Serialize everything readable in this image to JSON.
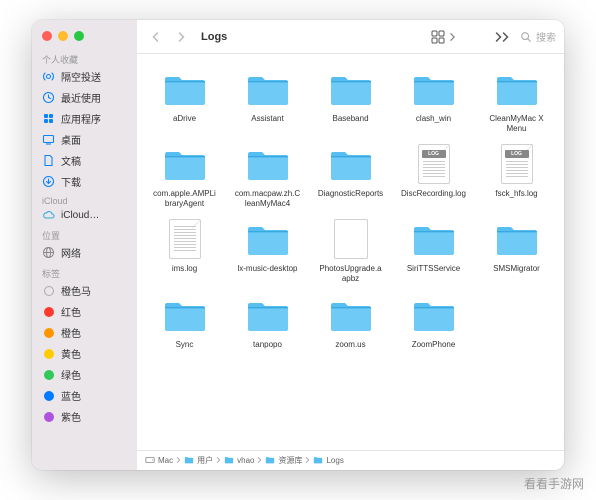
{
  "window_title": "Logs",
  "sidebar": {
    "sections": [
      {
        "header": "个人收藏",
        "items": [
          {
            "icon": "airdrop",
            "label": "隔空投送",
            "color": "#0a84ff"
          },
          {
            "icon": "clock",
            "label": "最近使用",
            "color": "#0a84ff"
          },
          {
            "icon": "apps",
            "label": "应用程序",
            "color": "#0a84ff"
          },
          {
            "icon": "desktop",
            "label": "桌面",
            "color": "#0a84ff"
          },
          {
            "icon": "doc",
            "label": "文稿",
            "color": "#0a84ff"
          },
          {
            "icon": "download",
            "label": "下载",
            "color": "#0a84ff"
          }
        ]
      },
      {
        "header": "iCloud",
        "items": [
          {
            "icon": "cloud",
            "label": "iCloud…",
            "color": "#34aadc"
          }
        ]
      },
      {
        "header": "位置",
        "items": [
          {
            "icon": "globe",
            "label": "网络",
            "color": "#888"
          }
        ]
      },
      {
        "header": "标签",
        "items": [
          {
            "icon": "tag",
            "label": "橙色马",
            "color": "#aaa"
          },
          {
            "icon": "tag",
            "label": "红色",
            "color": "#ff3b30"
          },
          {
            "icon": "tag",
            "label": "橙色",
            "color": "#ff9500"
          },
          {
            "icon": "tag",
            "label": "黄色",
            "color": "#ffcc00"
          },
          {
            "icon": "tag",
            "label": "绿色",
            "color": "#34c759"
          },
          {
            "icon": "tag",
            "label": "蓝色",
            "color": "#007aff"
          },
          {
            "icon": "tag",
            "label": "紫色",
            "color": "#af52de"
          }
        ]
      }
    ]
  },
  "search_placeholder": "搜索",
  "items": [
    {
      "type": "folder",
      "name": "aDrive"
    },
    {
      "type": "folder",
      "name": "Assistant"
    },
    {
      "type": "folder",
      "name": "Baseband"
    },
    {
      "type": "folder",
      "name": "clash_win"
    },
    {
      "type": "folder",
      "name": "CleanMyMac X Menu"
    },
    {
      "type": "folder",
      "name": "com.apple.AMPLibraryAgent"
    },
    {
      "type": "folder",
      "name": "com.macpaw.zh.CleanMyMac4"
    },
    {
      "type": "folder",
      "name": "DiagnosticReports"
    },
    {
      "type": "log",
      "name": "DiscRecording.log"
    },
    {
      "type": "log",
      "name": "fsck_hfs.log"
    },
    {
      "type": "txt",
      "name": "ims.log"
    },
    {
      "type": "folder",
      "name": "lx-music-desktop"
    },
    {
      "type": "pkg",
      "name": "PhotosUpgrade.aapbz"
    },
    {
      "type": "folder",
      "name": "SiriTTSService"
    },
    {
      "type": "folder",
      "name": "SMSMigrator"
    },
    {
      "type": "folder",
      "name": "Sync"
    },
    {
      "type": "folder",
      "name": "tanpopo"
    },
    {
      "type": "folder",
      "name": "zoom.us"
    },
    {
      "type": "folder",
      "name": "ZoomPhone"
    }
  ],
  "log_badge": "LOG",
  "path": [
    "Mac",
    "用户",
    "vhao",
    "资源库",
    "Logs"
  ],
  "watermark": "看看手游网"
}
